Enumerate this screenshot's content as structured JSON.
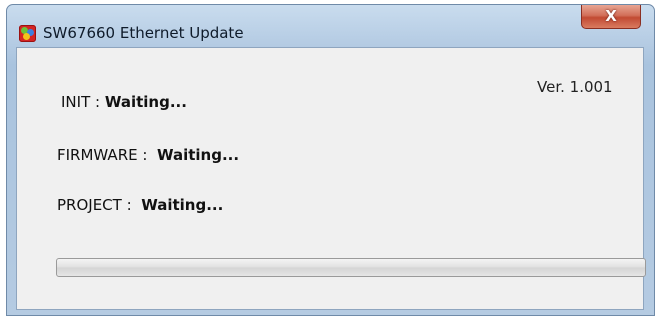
{
  "window": {
    "title": "SW67660 Ethernet Update",
    "close_glyph": "X",
    "icon": "app-logo-icon"
  },
  "version": "Ver. 1.001",
  "status": {
    "init_label": "INIT : ",
    "init_value": "Waiting...",
    "firmware_label": "FIRMWARE : ",
    "firmware_value": "Waiting...",
    "project_label": "PROJECT : ",
    "project_value": "Waiting..."
  },
  "progress": {
    "value": 0
  }
}
